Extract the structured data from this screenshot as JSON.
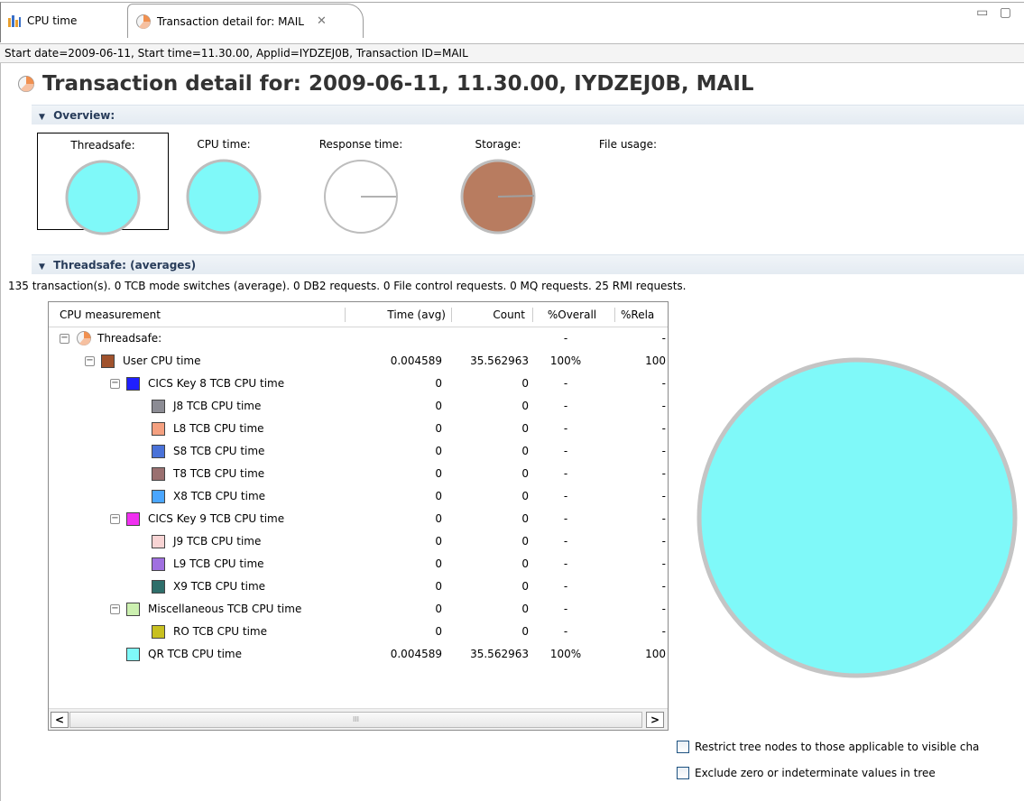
{
  "tabs": [
    {
      "label": "CPU time",
      "icon": "bar-chart-icon"
    },
    {
      "label": "Transaction detail for: MAIL",
      "icon": "pie-chart-icon",
      "close": "✕"
    }
  ],
  "infoline": "Start date=2009-06-11, Start time=11.30.00, Applid=IYDZEJ0B, Transaction ID=MAIL",
  "title": "Transaction detail for: 2009-06-11, 11.30.00, IYDZEJ0B, MAIL",
  "overview": {
    "header": "Overview:",
    "items": [
      {
        "label": "Threadsafe:",
        "color": "#7ff9f9"
      },
      {
        "label": "CPU time:",
        "color": "#7ff9f9"
      },
      {
        "label": "Response time:",
        "color": "#ffffff"
      },
      {
        "label": "Storage:",
        "color": "#b87c60"
      },
      {
        "label": "File usage:"
      }
    ]
  },
  "threadsafe": {
    "header": "Threadsafe: (averages)",
    "summary": "135 transaction(s). 0 TCB mode switches (average). 0 DB2 requests. 0 File control requests. 0 MQ requests. 25 RMI requests."
  },
  "tree": {
    "columns": [
      "CPU measurement",
      "Time (avg)",
      "Count",
      "%Overall",
      "%Rela"
    ],
    "rows": [
      {
        "level": 0,
        "expand": "⊟",
        "icon": "pie",
        "label": "Threadsafe:",
        "time": "",
        "count": "",
        "overall": "-",
        "rel": "-"
      },
      {
        "level": 1,
        "expand": "⊟",
        "color": "#a0522d",
        "label": "User CPU time",
        "time": "0.004589",
        "count": "35.562963",
        "overall": "100%",
        "rel": "100"
      },
      {
        "level": 2,
        "expand": "⊟",
        "color": "#1f1fff",
        "label": "CICS Key 8 TCB CPU time",
        "time": "0",
        "count": "0",
        "overall": "-",
        "rel": "-"
      },
      {
        "level": 3,
        "color": "#8c8c94",
        "label": "J8 TCB CPU time",
        "time": "0",
        "count": "0",
        "overall": "-",
        "rel": "-"
      },
      {
        "level": 3,
        "color": "#f4a080",
        "label": "L8 TCB CPU time",
        "time": "0",
        "count": "0",
        "overall": "-",
        "rel": "-"
      },
      {
        "level": 3,
        "color": "#4a72d8",
        "label": "S8 TCB CPU time",
        "time": "0",
        "count": "0",
        "overall": "-",
        "rel": "-"
      },
      {
        "level": 3,
        "color": "#9a7070",
        "label": "T8 TCB CPU time",
        "time": "0",
        "count": "0",
        "overall": "-",
        "rel": "-"
      },
      {
        "level": 3,
        "color": "#4aa6ff",
        "label": "X8 TCB CPU time",
        "time": "0",
        "count": "0",
        "overall": "-",
        "rel": "-"
      },
      {
        "level": 2,
        "expand": "⊟",
        "color": "#f030f0",
        "label": "CICS Key 9 TCB CPU time",
        "time": "0",
        "count": "0",
        "overall": "-",
        "rel": "-"
      },
      {
        "level": 3,
        "color": "#f8d4d4",
        "label": "J9 TCB CPU time",
        "time": "0",
        "count": "0",
        "overall": "-",
        "rel": "-"
      },
      {
        "level": 3,
        "color": "#a070e0",
        "label": "L9 TCB CPU time",
        "time": "0",
        "count": "0",
        "overall": "-",
        "rel": "-"
      },
      {
        "level": 3,
        "color": "#2e6e6a",
        "label": "X9 TCB CPU time",
        "time": "0",
        "count": "0",
        "overall": "-",
        "rel": "-"
      },
      {
        "level": 2,
        "expand": "⊟",
        "color": "#ccf0b0",
        "label": "Miscellaneous TCB CPU time",
        "time": "0",
        "count": "0",
        "overall": "-",
        "rel": "-"
      },
      {
        "level": 3,
        "color": "#c8c020",
        "label": "RO TCB CPU time",
        "time": "0",
        "count": "0",
        "overall": "-",
        "rel": "-"
      },
      {
        "level": 2,
        "color": "#7ff9f9",
        "label": "QR TCB CPU time",
        "time": "0.004589",
        "count": "35.562963",
        "overall": "100%",
        "rel": "100"
      }
    ]
  },
  "scroll": {
    "left": "<",
    "right": ">",
    "thumb": "III"
  },
  "checkboxes": [
    "Restrict tree nodes to those applicable to visible cha",
    "Exclude zero or indeterminate values in tree"
  ],
  "pie_color": "#7ff9f9",
  "window_controls": "▭ ▢"
}
